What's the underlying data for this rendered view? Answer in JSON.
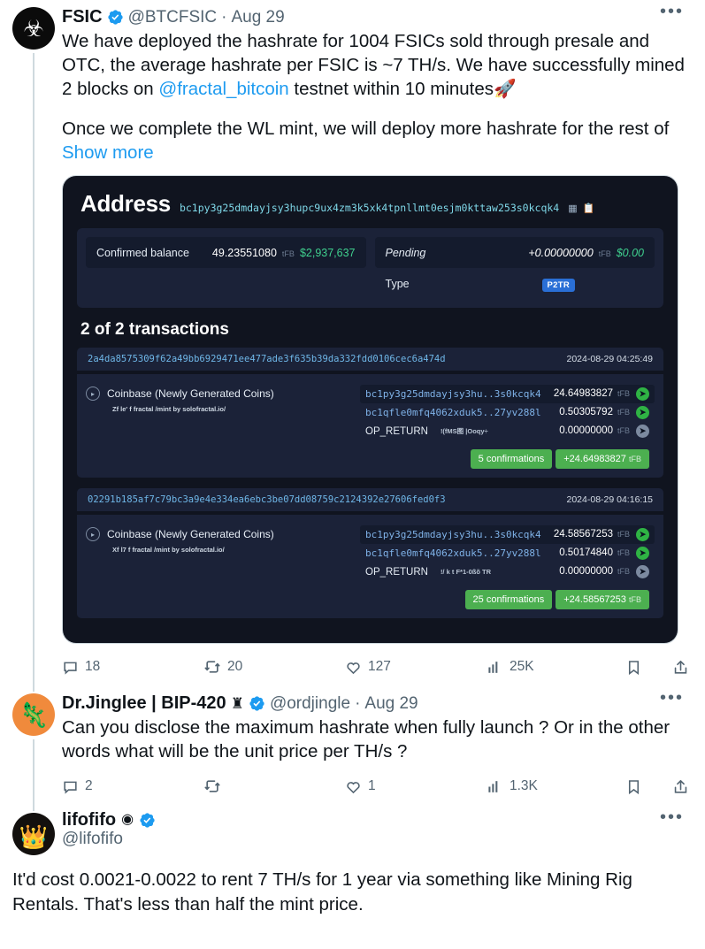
{
  "tweets": [
    {
      "author": {
        "display_name": "FSIC",
        "handle": "@BTCFSIC",
        "separator": "·",
        "date": "Aug 29",
        "verified": true,
        "avatar": "fsic-fractal-logo-avatar"
      },
      "text_line1": "We have deployed the hashrate for 1004 FSICs sold through presale and OTC, the average hashrate per FSIC is ~7 TH/s. We have successfully mined 2 blocks on ",
      "mention": "@fractal_bitcoin",
      "text_line2": " testnet within 10 minutes🚀",
      "text_line3": "Once we complete the WL mint, we will deploy more hashrate for the rest of",
      "show_more": "Show more",
      "actions": {
        "reply": "18",
        "retweet": "20",
        "like": "127",
        "views": "25K",
        "bookmark_label": "",
        "share_label": ""
      },
      "more_button": "•••"
    },
    {
      "author": {
        "display_name": "Dr.Jinglee | BIP-420",
        "crown": "♜",
        "handle": "@ordjingle",
        "separator": "·",
        "date": "Aug 29",
        "verified": true,
        "avatar": "jinglee-orange-avatar"
      },
      "text": "Can you disclose the maximum hashrate when fully launch ? Or in the other words what will be the unit price per TH/s ?",
      "actions": {
        "reply": "2",
        "retweet": "",
        "like": "1",
        "views": "1.3K"
      },
      "more_button": "•••"
    },
    {
      "author": {
        "display_name": "lifofifo",
        "badge": "◉",
        "handle": "@lifofifo",
        "verified": true,
        "avatar": "lifofifo-crown-avatar"
      },
      "text": "It'd cost 0.0021-0.0022 to rent 7 TH/s for 1 year via something like Mining Rig Rentals. That's less than half the mint price.",
      "more_button": "•••"
    }
  ],
  "explorer_card": {
    "title": "Address",
    "address": "bc1py3g25dmdayjsy3hupc9ux4zm3k5xk4tpnllmt0esjm0kttaw253s0kcqk4",
    "header_icons": [
      "qr-code-icon",
      "copy-icon"
    ],
    "summary": {
      "confirmed_balance": {
        "label": "Confirmed balance",
        "amount": "49.23551080",
        "unit": "tFB",
        "usd": "$2,937,637"
      },
      "pending": {
        "label": "Pending",
        "amount": "+0.00000000",
        "unit": "tFB",
        "usd": "$0.00"
      },
      "type": {
        "label": "Type",
        "value": "P2TR"
      }
    },
    "transactions_heading": "2 of 2 transactions",
    "transactions": [
      {
        "txid": "2a4da8575309f62a49bb6929471ee477ade3f635b39da332fdd0106cec6a474d",
        "timestamp": "2024-08-29 04:25:49",
        "input_label": "Coinbase (Newly Generated Coins)",
        "input_script": "Zf le'  f fractal /mint by solofractal.io/",
        "outputs": [
          {
            "address": "bc1py3g25dmdayjsy3hu..3s0kcqk4",
            "amount": "24.64983827",
            "unit": "tFB",
            "type": "address",
            "arrow": "green"
          },
          {
            "address": "bc1qfle0mfq4062xduk5..27yv288l",
            "amount": "0.50305792",
            "unit": "tFB",
            "type": "address",
            "arrow": "green"
          },
          {
            "address": "OP_RETURN",
            "garble": "!(fMS图 |Ooqy÷",
            "amount": "0.00000000",
            "unit": "tFB",
            "type": "op_return",
            "arrow": "muted"
          }
        ],
        "confirmations": "5 confirmations",
        "total": "+24.64983827",
        "total_unit": "tFB"
      },
      {
        "txid": "02291b185af7c79bc3a9e4e334ea6ebc3be07dd08759c2124392e27606fed0f3",
        "timestamp": "2024-08-29 04:16:15",
        "input_label": "Coinbase (Newly Generated Coins)",
        "input_script": "Xf l7  f  fractal /mint by solofractal.io/",
        "outputs": [
          {
            "address": "bc1py3g25dmdayjsy3hu..3s0kcqk4",
            "amount": "24.58567253",
            "unit": "tFB",
            "type": "address",
            "arrow": "green"
          },
          {
            "address": "bc1qfle0mfq4062xduk5..27yv288l",
            "amount": "0.50174840",
            "unit": "tFB",
            "type": "address",
            "arrow": "green"
          },
          {
            "address": "OP_RETURN",
            "garble": "!/ k t  F*1-0ßõ TR",
            "amount": "0.00000000",
            "unit": "tFB",
            "type": "op_return",
            "arrow": "muted"
          }
        ],
        "confirmations": "25 confirmations",
        "total": "+24.58567253",
        "total_unit": "tFB"
      }
    ]
  },
  "colors": {
    "link": "#1d9bf0",
    "verified_blue": "#1d9bf0",
    "muted_text": "#536471",
    "card_bg": "#10141f",
    "panel_bg": "#1b2238",
    "green": "#4caf50",
    "usd_green": "#3fcf8e",
    "badge_blue": "#2a6fd6"
  }
}
